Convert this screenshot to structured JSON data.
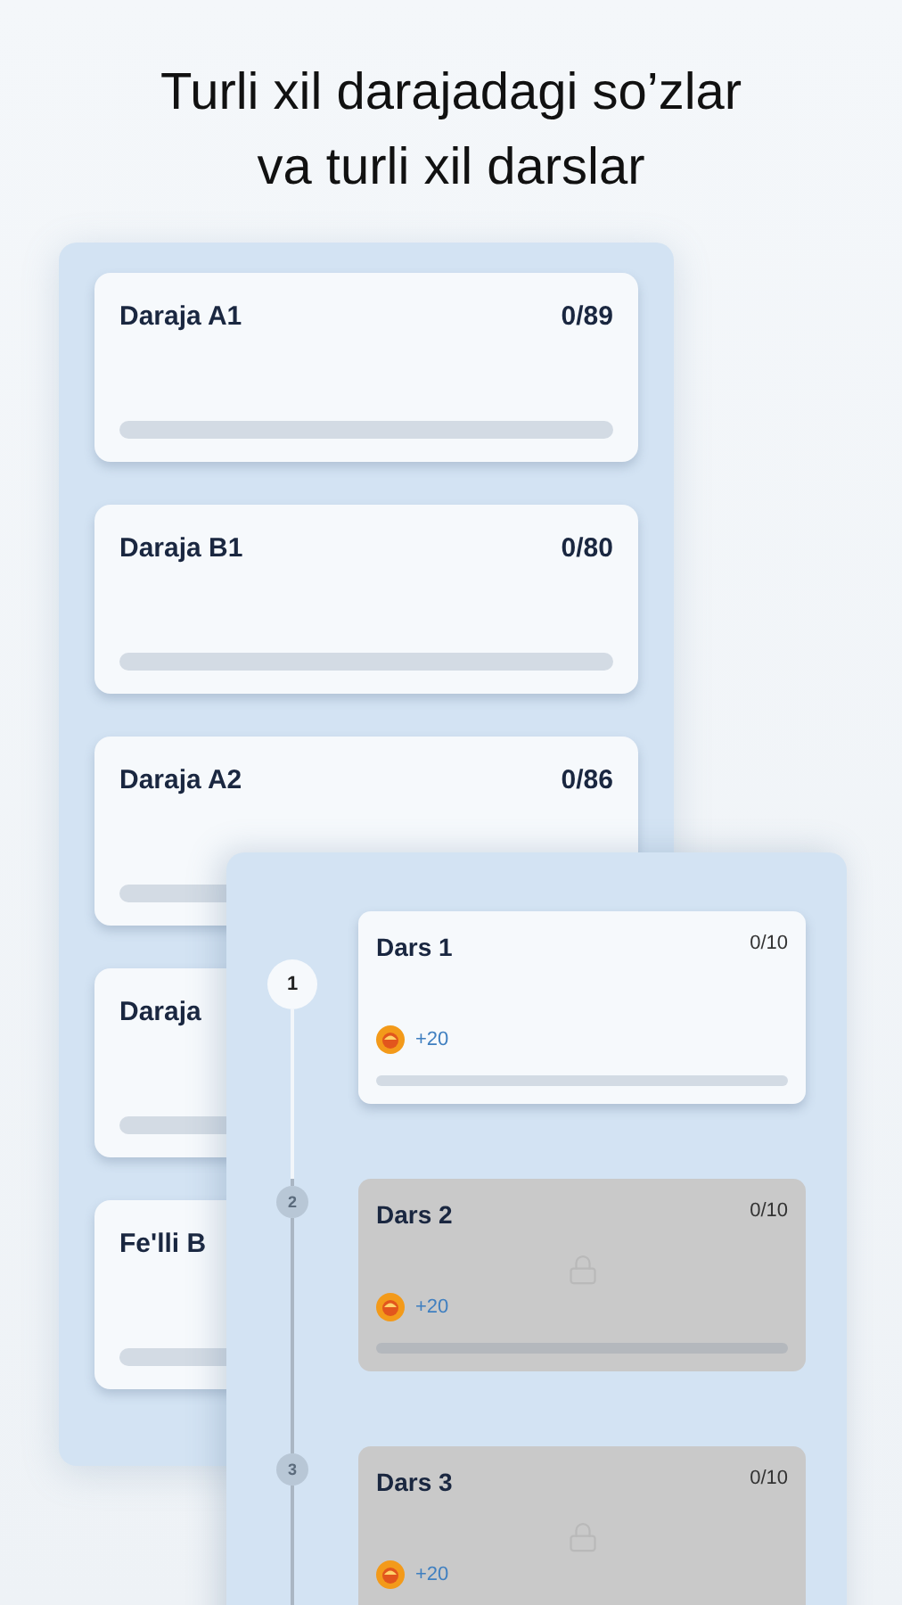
{
  "headline": [
    "Turli xil darajadagi so’zlar",
    "va turli xil darslar"
  ],
  "levels": [
    {
      "title": "Daraja A1",
      "count": "0/89",
      "level": 0
    },
    {
      "title": "Daraja B1",
      "count": "0/80",
      "level": 0
    },
    {
      "title": "Daraja A2",
      "count": "0/86",
      "level": 0
    },
    {
      "title": "Daraja",
      "level": 0
    },
    {
      "title": "Fe'lli B",
      "level": 0
    }
  ],
  "lessons": [
    {
      "step": "1",
      "title": "Dars 1",
      "count": "0/10",
      "reward": "+20",
      "locked": false,
      "selected": true,
      "level": 0
    },
    {
      "step": "2",
      "title": "Dars 2",
      "count": "0/10",
      "reward": "+20",
      "locked": true,
      "selected": false,
      "level": 0
    },
    {
      "step": "3",
      "title": "Dars 3",
      "count": "0/10",
      "reward": "+20",
      "locked": true,
      "selected": false
    }
  ]
}
